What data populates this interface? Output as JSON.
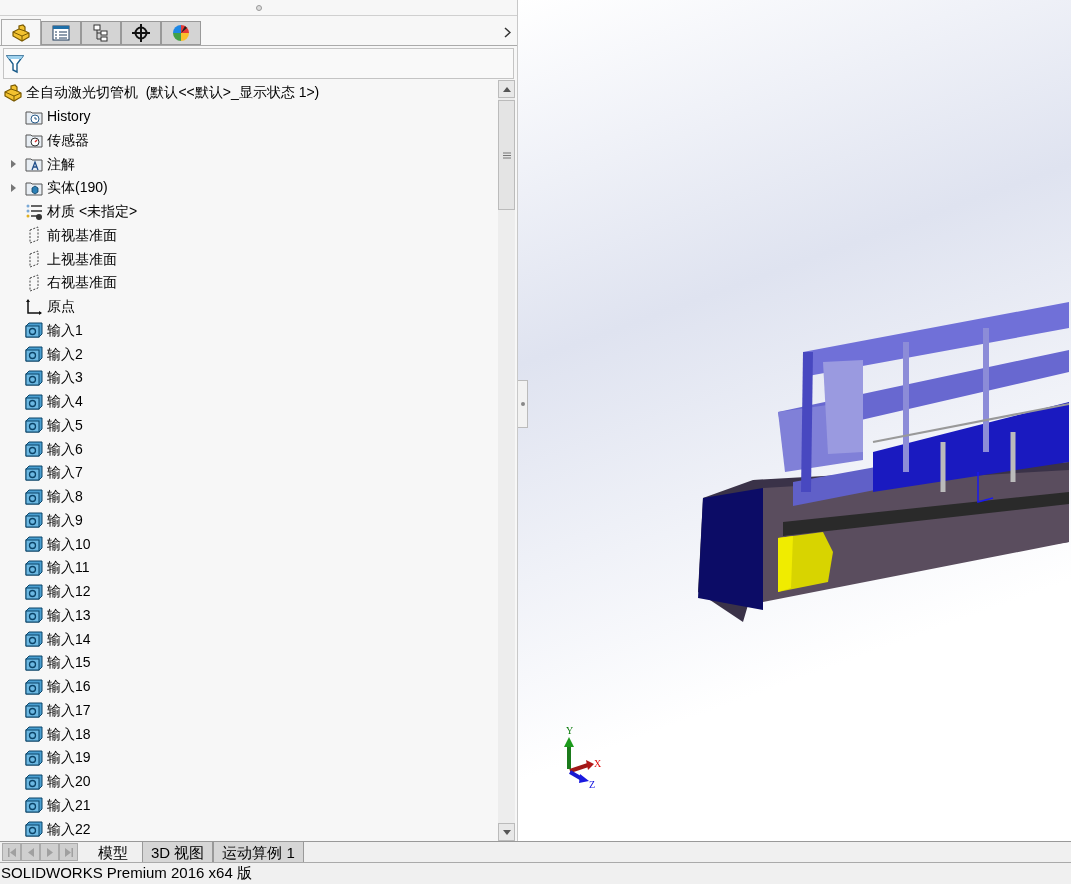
{
  "panel_tabs": [
    {
      "kind": "feature",
      "selected": true
    },
    {
      "kind": "property",
      "selected": false
    },
    {
      "kind": "config",
      "selected": false
    },
    {
      "kind": "target",
      "selected": false
    },
    {
      "kind": "display",
      "selected": false
    }
  ],
  "tree": {
    "root": {
      "label": "全自动激光切管机  (默认<<默认>_显示状态 1>)"
    },
    "items": [
      {
        "kind": "history",
        "label": "History"
      },
      {
        "kind": "sensor",
        "label": "传感器"
      },
      {
        "kind": "annotation",
        "label": "注解",
        "expanded": false
      },
      {
        "kind": "solid",
        "label": "实体(190)",
        "expanded": false
      },
      {
        "kind": "material",
        "label": "材质 <未指定>"
      },
      {
        "kind": "plane",
        "label": "前视基准面"
      },
      {
        "kind": "plane",
        "label": "上视基准面"
      },
      {
        "kind": "plane",
        "label": "右视基准面"
      },
      {
        "kind": "origin",
        "label": "原点"
      },
      {
        "kind": "part",
        "label": "输入1"
      },
      {
        "kind": "part",
        "label": "输入2"
      },
      {
        "kind": "part",
        "label": "输入3"
      },
      {
        "kind": "part",
        "label": "输入4"
      },
      {
        "kind": "part",
        "label": "输入5"
      },
      {
        "kind": "part",
        "label": "输入6"
      },
      {
        "kind": "part",
        "label": "输入7"
      },
      {
        "kind": "part",
        "label": "输入8"
      },
      {
        "kind": "part",
        "label": "输入9"
      },
      {
        "kind": "part",
        "label": "输入10"
      },
      {
        "kind": "part",
        "label": "输入11"
      },
      {
        "kind": "part",
        "label": "输入12"
      },
      {
        "kind": "part",
        "label": "输入13"
      },
      {
        "kind": "part",
        "label": "输入14"
      },
      {
        "kind": "part",
        "label": "输入15"
      },
      {
        "kind": "part",
        "label": "输入16"
      },
      {
        "kind": "part",
        "label": "输入17"
      },
      {
        "kind": "part",
        "label": "输入18"
      },
      {
        "kind": "part",
        "label": "输入19"
      },
      {
        "kind": "part",
        "label": "输入20"
      },
      {
        "kind": "part",
        "label": "输入21"
      },
      {
        "kind": "part",
        "label": "输入22"
      }
    ]
  },
  "bottom_tabs": [
    {
      "label": "模型",
      "selected": true
    },
    {
      "label": "3D 视图",
      "selected": false
    },
    {
      "label": "运动算例 1",
      "selected": false
    }
  ],
  "triad": {
    "x": "X",
    "y": "Y",
    "z": "Z"
  },
  "status_bar": {
    "text": "SOLIDWORKS Premium 2016 x64 版"
  }
}
